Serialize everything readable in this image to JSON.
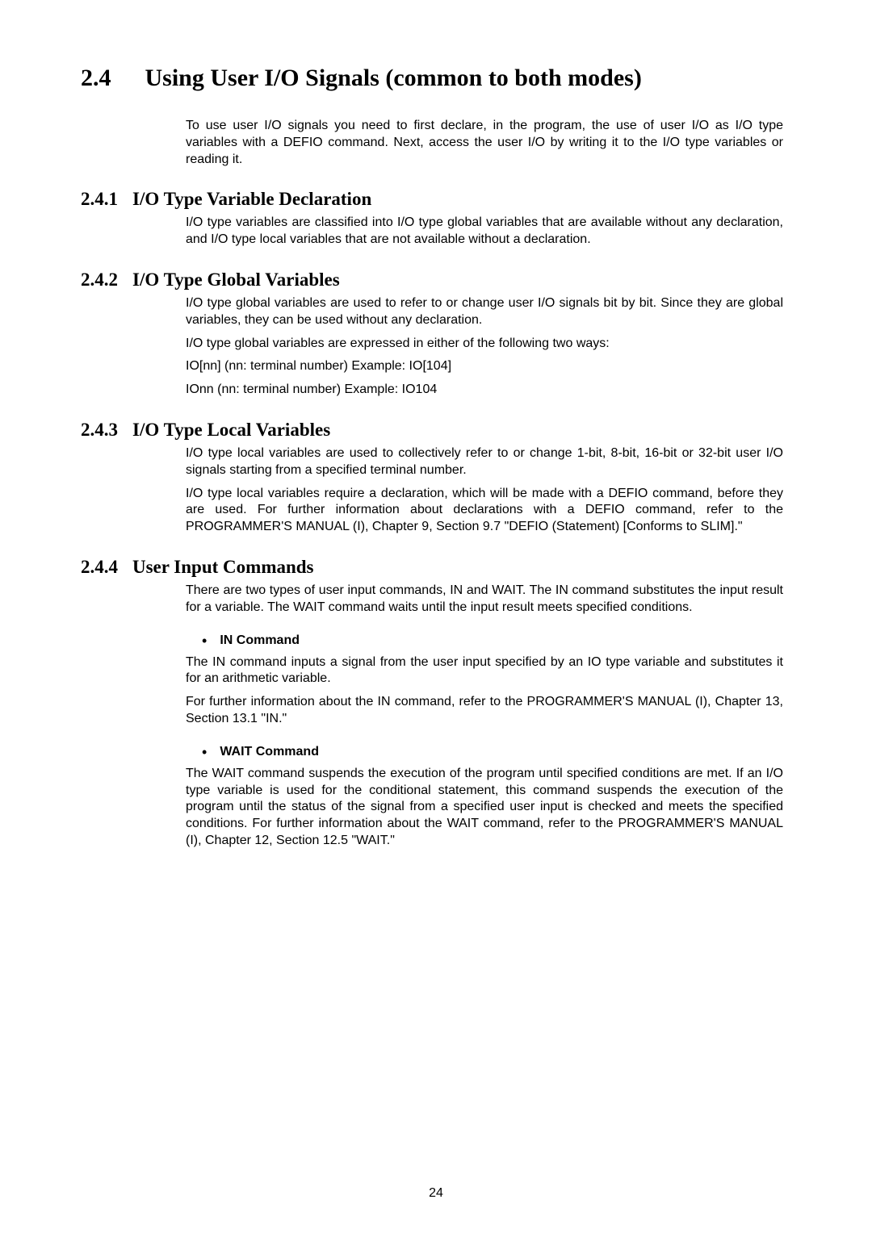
{
  "section": {
    "num": "2.4",
    "title": "Using User I/O Signals (common to both modes)",
    "intro": "To use user I/O signals you need to first declare, in the program, the use of user I/O as I/O type variables with a DEFIO command. Next, access the user I/O by writing it to the I/O type variables or reading it."
  },
  "sub1": {
    "num": "2.4.1",
    "title": "I/O Type Variable Declaration",
    "p1": "I/O type variables are classified into I/O type global variables that are available without any declaration, and I/O type local variables that are not available without a declaration."
  },
  "sub2": {
    "num": "2.4.2",
    "title": "I/O Type Global Variables",
    "p1": "I/O type global variables are used to refer to or change user I/O signals bit by bit. Since they are global variables, they can be used without any declaration.",
    "p2": "I/O type global variables are expressed in either of the following two ways:",
    "p3": "IO[nn]    (nn: terminal number)    Example: IO[104]",
    "p4": "IOnn  (nn: terminal number)    Example: IO104"
  },
  "sub3": {
    "num": "2.4.3",
    "title": "I/O Type Local Variables",
    "p1": "I/O type local variables are used to collectively refer to or change 1-bit, 8-bit, 16-bit or 32-bit user I/O signals starting from a specified terminal number.",
    "p2": "I/O type local variables require a declaration, which will be made with a DEFIO command, before they are used. For further information about declarations with a DEFIO command, refer to the PROGRAMMER'S MANUAL (I), Chapter 9, Section 9.7 \"DEFIO (Statement) [Conforms to SLIM].\""
  },
  "sub4": {
    "num": "2.4.4",
    "title": "User Input Commands",
    "p1": "There are two types of user input commands, IN and WAIT. The IN command substitutes the input result for a variable. The WAIT command waits until the input result meets specified conditions.",
    "b1": {
      "title": "IN Command",
      "p1": "The IN command inputs a signal from the user input specified by an IO type variable and substitutes it for an arithmetic variable.",
      "p2": "For further information about the IN command, refer to the PROGRAMMER'S MANUAL (I), Chapter 13, Section 13.1 \"IN.\""
    },
    "b2": {
      "title": "WAIT Command",
      "p1": "The WAIT command suspends the execution of the program until specified conditions are met. If an I/O type variable is used for the conditional statement, this command suspends the execution of the program until the status of the signal from a specified user input is checked and meets the specified conditions. For further information about the WAIT command, refer to the PROGRAMMER'S MANUAL (I), Chapter 12, Section 12.5 \"WAIT.\""
    }
  },
  "page": "24"
}
